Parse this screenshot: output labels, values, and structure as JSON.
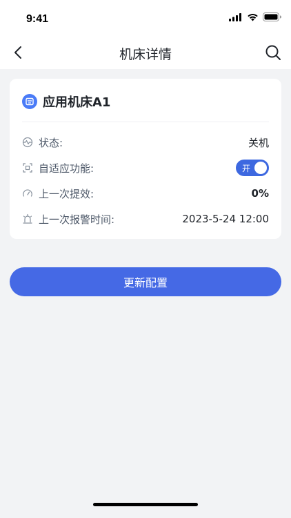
{
  "status_bar": {
    "time": "9:41"
  },
  "nav": {
    "title": "机床详情"
  },
  "card": {
    "title": "应用机床A1",
    "rows": [
      {
        "label": "状态:",
        "value": "关机"
      },
      {
        "label": "自适应功能:",
        "toggle_label": "开"
      },
      {
        "label": "上一次提效:",
        "value": "0%"
      },
      {
        "label": "上一次报警时间:",
        "value": "2023-5-24 12:00"
      }
    ]
  },
  "actions": {
    "update_label": "更新配置"
  },
  "colors": {
    "accent": "#4569E5",
    "toggle_on": "#3D68E0",
    "background": "#F2F3F5"
  },
  "icons": {
    "status": "pulse-icon",
    "adaptive": "scan-icon",
    "efficiency": "gauge-icon",
    "alarm": "alarm-icon"
  }
}
